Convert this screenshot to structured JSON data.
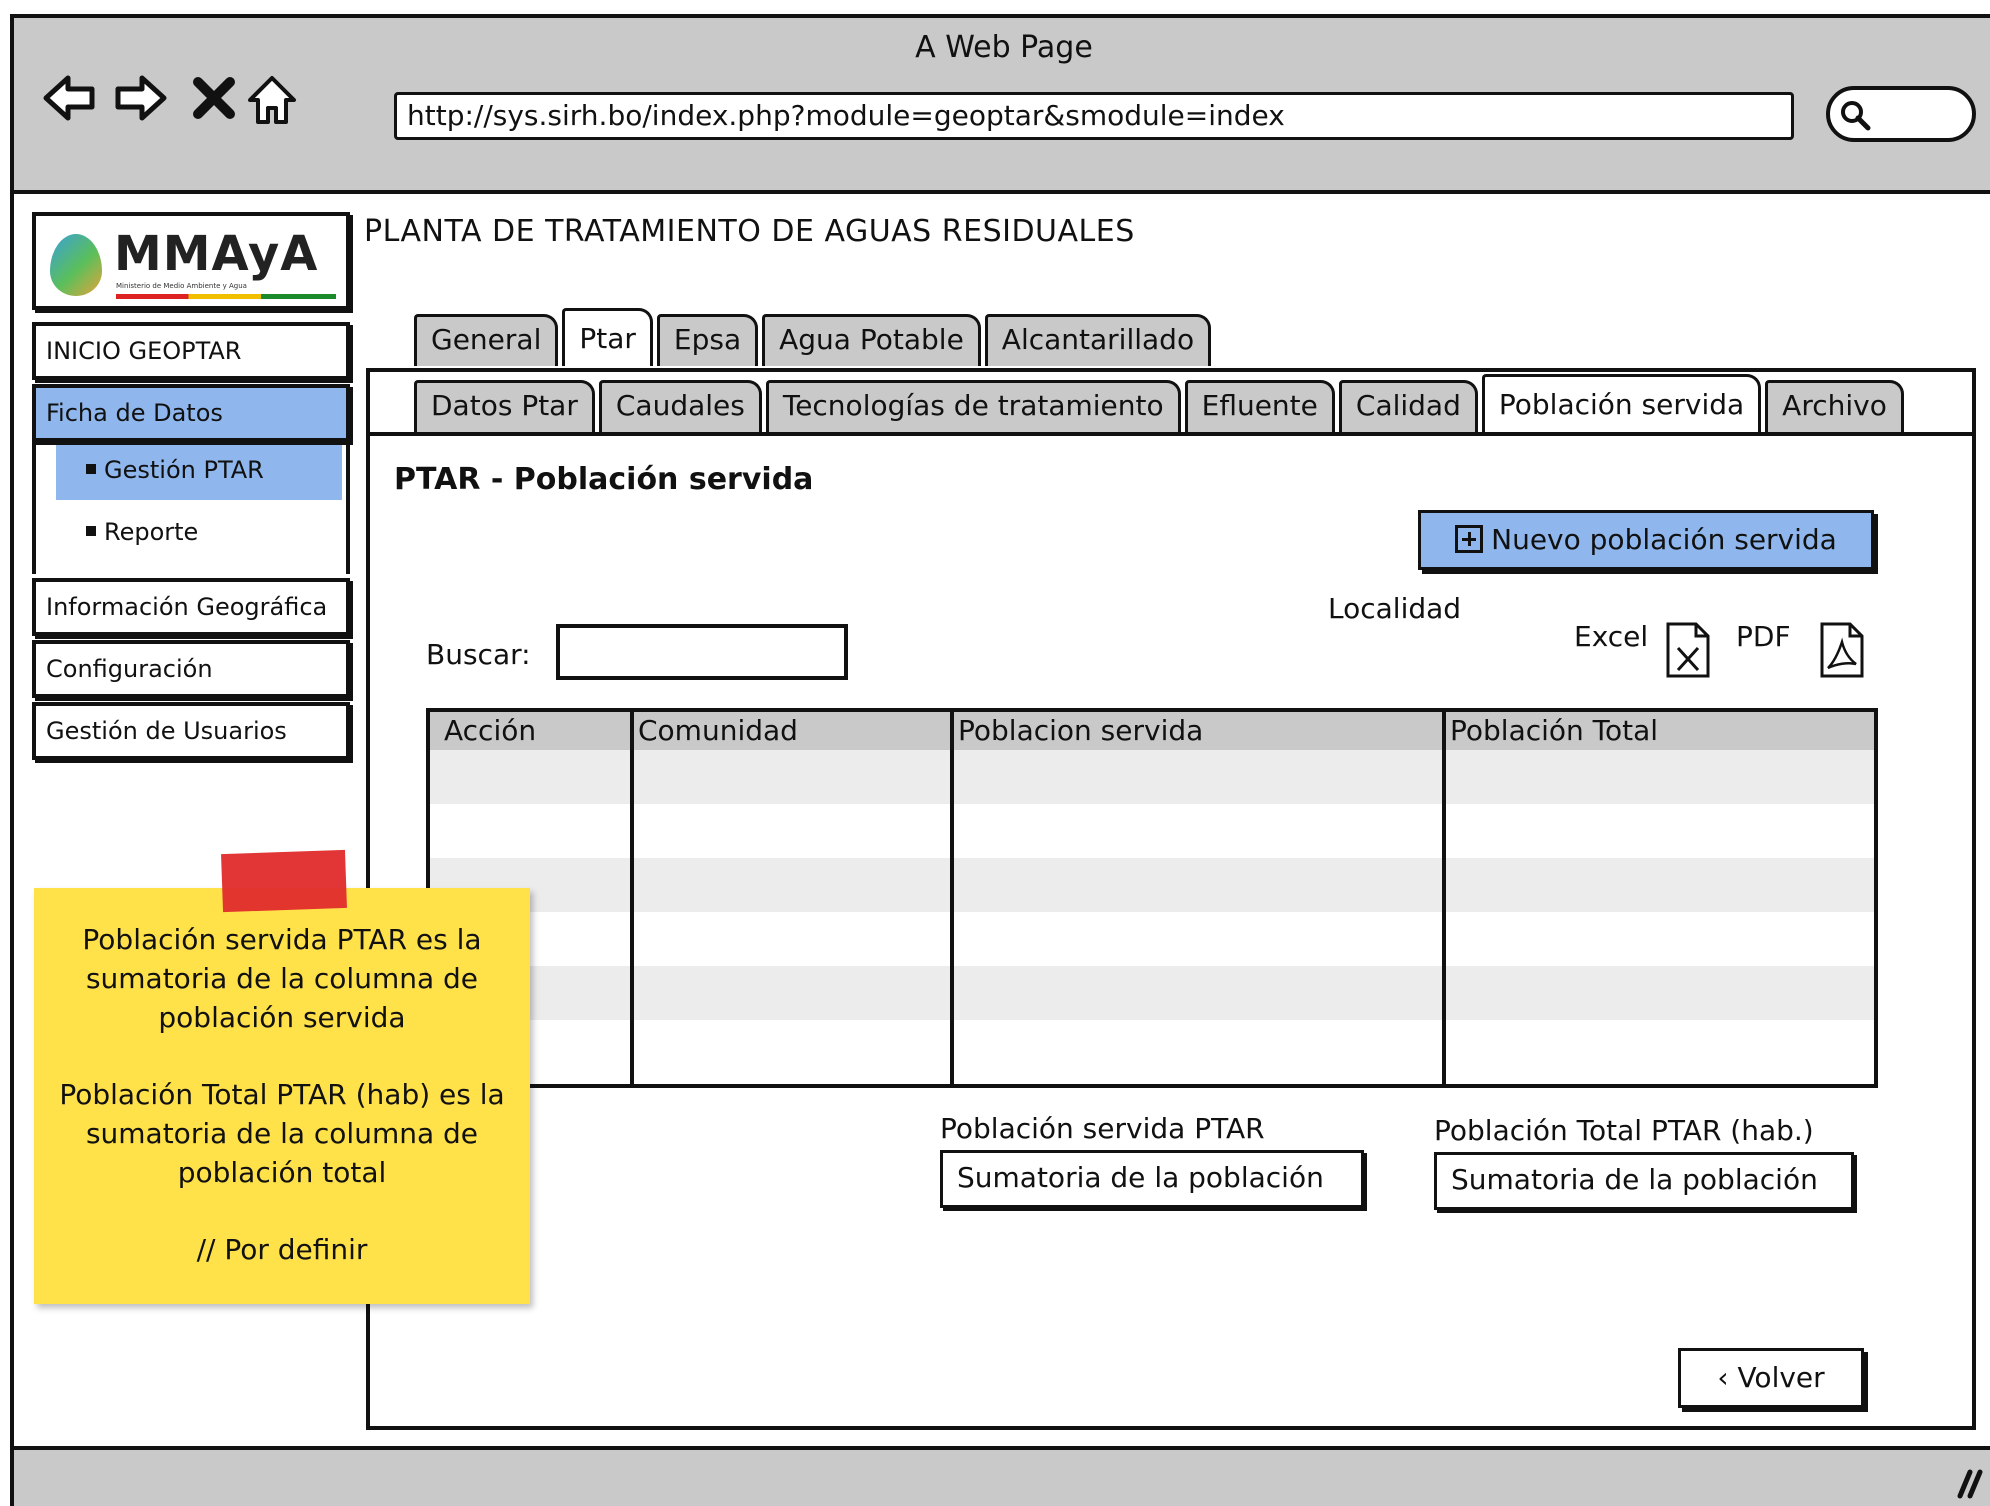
{
  "browser": {
    "window_title": "A Web Page",
    "url": "http://sys.sirh.bo/index.php?module=geoptar&smodule=index",
    "nav_icons": [
      "back-arrow-icon",
      "forward-arrow-icon",
      "close-x-icon",
      "home-icon"
    ],
    "search_icon": "magnifier-icon"
  },
  "logo": {
    "name": "MMAyA",
    "subtitle": "Ministerio de Medio Ambiente y Agua"
  },
  "sidebar": {
    "items": [
      {
        "label": "INICIO GEOPTAR"
      },
      {
        "label": "Ficha de Datos",
        "active": true
      },
      {
        "label": "Información Geográfica"
      },
      {
        "label": "Configuración"
      },
      {
        "label": "Gestión de Usuarios"
      }
    ],
    "subitems": [
      {
        "label": "Gestión PTAR",
        "active": true
      },
      {
        "label": "Reporte"
      }
    ]
  },
  "page_title": "PLANTA DE TRATAMIENTO DE AGUAS RESIDUALES",
  "tabs_main": [
    "General",
    "Ptar",
    "Epsa",
    "Agua Potable",
    "Alcantarillado"
  ],
  "tabs_main_active": "Ptar",
  "tabs_sub": [
    "Datos Ptar",
    "Caudales",
    "Tecnologías de tratamiento",
    "Efluente",
    "Calidad",
    "Población servida",
    "Archivo"
  ],
  "tabs_sub_active": "Población servida",
  "section": {
    "title": "PTAR - Población servida",
    "new_button": "Nuevo población servida",
    "localidad_label": "Localidad",
    "search_label": "Buscar:",
    "search_value": "",
    "export_excel": "Excel",
    "export_pdf": "PDF"
  },
  "table": {
    "columns": [
      "Acción",
      "Comunidad",
      "Poblacion servida",
      "Población Total"
    ],
    "rows": []
  },
  "summary": {
    "servida_label": "Población servida PTAR",
    "servida_value": "Sumatoria de la población",
    "total_label": "Población Total PTAR (hab.)",
    "total_value": "Sumatoria de la población"
  },
  "back_button": "Volver",
  "sticky_note": {
    "p1": "Población servida PTAR es la sumatoria de la columna de población servida",
    "p2": "Población Total PTAR (hab) es la sumatoria de la columna de población total",
    "p3": "// Por definir"
  },
  "colors": {
    "chrome": "#c9c9c9",
    "highlight": "#8fb7ee",
    "note": "#ffe14a",
    "tape": "#e02b2b"
  }
}
